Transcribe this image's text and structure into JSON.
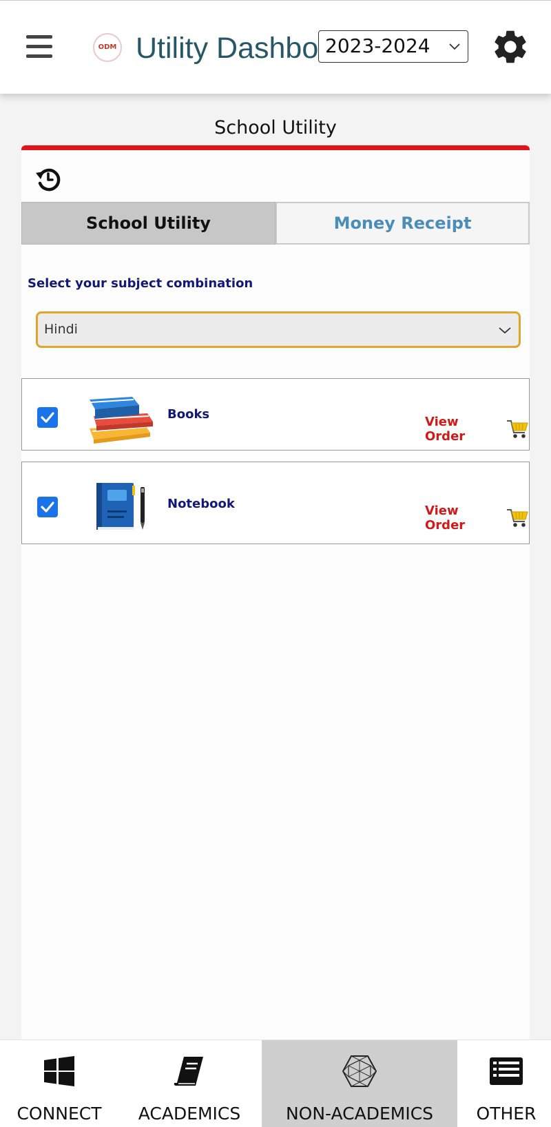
{
  "header": {
    "logo_text": "ODM",
    "title": "Utility Dashboard",
    "year_select": {
      "selected": "2023-2024"
    }
  },
  "page": {
    "title": "School Utility"
  },
  "tabs": [
    {
      "label": "School Utility",
      "active": true
    },
    {
      "label": "Money Receipt",
      "active": false
    }
  ],
  "subject": {
    "label": "Select your subject combination",
    "selected": "Hindi"
  },
  "items": [
    {
      "label": "Books",
      "checked": true,
      "action": "View Order",
      "icon": "books-icon"
    },
    {
      "label": "Notebook",
      "checked": true,
      "action": "View Order",
      "icon": "notebook-icon"
    }
  ],
  "bottom_nav": [
    {
      "label": "CONNECT",
      "icon": "windows-icon",
      "active": false
    },
    {
      "label": "ACADEMICS",
      "icon": "book-icon",
      "active": false
    },
    {
      "label": "NON-ACADEMICS",
      "icon": "geodesic-icon",
      "active": true
    },
    {
      "label": "OTHER",
      "icon": "list-icon",
      "active": false
    }
  ],
  "colors": {
    "accent_red": "#e3131b",
    "title_teal": "#275766",
    "label_navy": "#12177a",
    "link_blue": "#4a8cba",
    "select_border": "#e0a52b",
    "checkbox_blue": "#1a73e8"
  }
}
